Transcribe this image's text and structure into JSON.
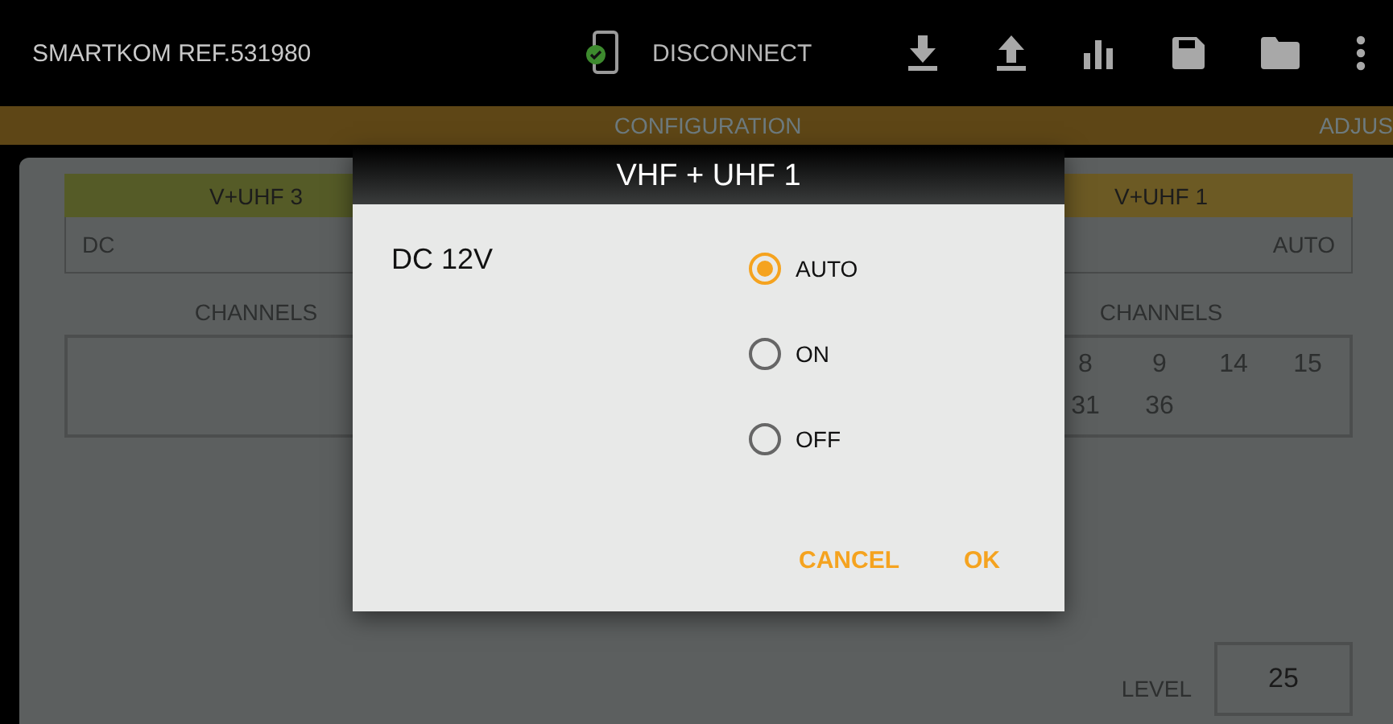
{
  "app_bar": {
    "title": "SMARTKOM REF.531980",
    "connection": "DISCONNECT"
  },
  "tabs": [
    {
      "label": "CONFIGURATION"
    },
    {
      "label": "ADJUS"
    }
  ],
  "outputs": [
    {
      "name": "V+UHF 3",
      "color": "#555b27",
      "dc_label": "DC",
      "channels_label": "CHANNELS"
    },
    {
      "name": "V+UHF 1",
      "color": "#6c5a24",
      "dc_value": "AUTO",
      "channels_label": "CHANNELS",
      "channels": [
        "8",
        "9",
        "14",
        "15",
        "31",
        "36"
      ]
    }
  ],
  "gain": {
    "label": "LEVEL",
    "value": "25"
  },
  "dialog": {
    "title": "VHF + UHF 1",
    "label": "DC 12V",
    "options": [
      {
        "label": "AUTO",
        "selected": true
      },
      {
        "label": "ON",
        "selected": false
      },
      {
        "label": "OFF",
        "selected": false
      }
    ],
    "buttons": [
      "CANCEL",
      "OK"
    ]
  }
}
